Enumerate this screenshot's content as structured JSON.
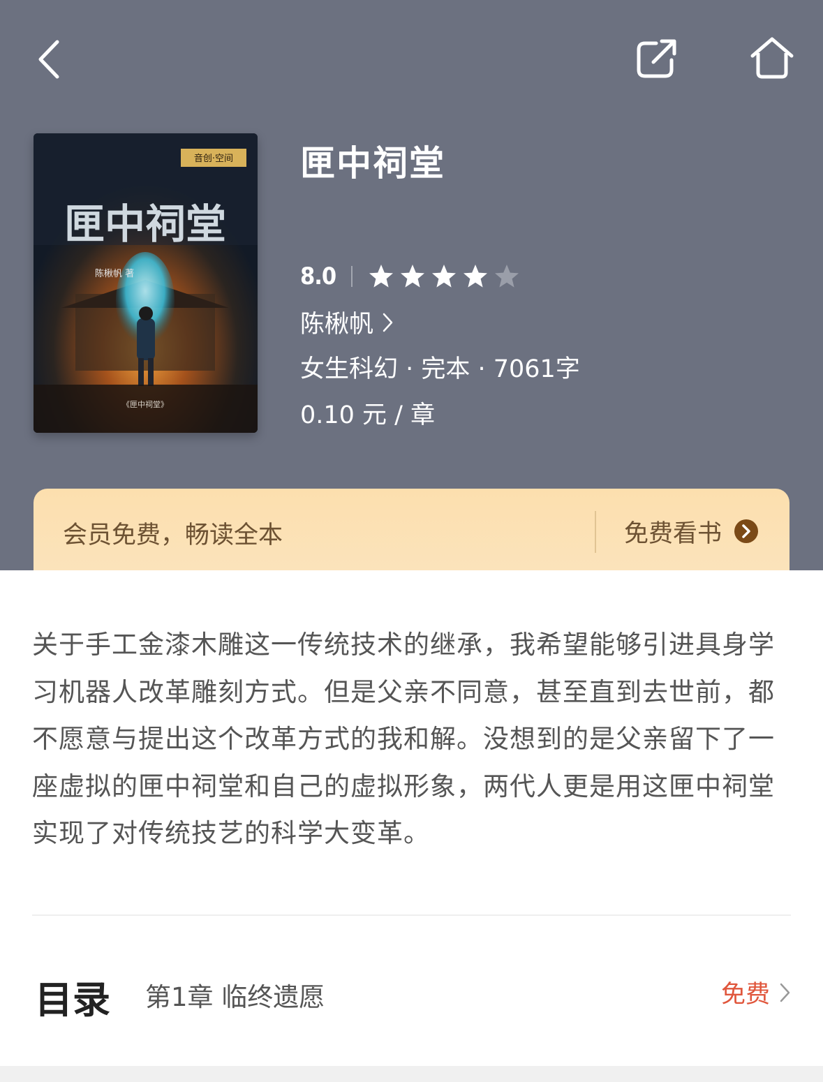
{
  "nav": {
    "back_icon": "chevron-left-icon",
    "share_icon": "share-icon",
    "home_icon": "home-icon"
  },
  "book": {
    "title": "匣中祠堂",
    "cover_title": "匣中祠堂",
    "cover_author": "陈楸帆 著",
    "cover_publisher": "音创·空间",
    "cover_caption": "《匣中祠堂》",
    "score": "8.0",
    "stars_filled": 4,
    "stars_total": 5,
    "author": "陈楸帆",
    "meta": "女生科幻 · 完本 · 7061字",
    "price": "0.10 元 / 章"
  },
  "vip": {
    "text": "会员免费，畅读全本",
    "button_label": "免费看书"
  },
  "synopsis": "关于手工金漆木雕这一传统技术的继承，我希望能够引进具身学习机器人改革雕刻方式。但是父亲不同意，甚至直到去世前，都不愿意与提出这个改革方式的我和解。没想到的是父亲留下了一座虚拟的匣中祠堂和自己的虚拟形象，两代人更是用这匣中祠堂实现了对传统技艺的科学大变革。",
  "toc": {
    "title": "目录",
    "chapter": "第1章 临终遗愿",
    "free_label": "免费"
  },
  "colors": {
    "header_bg": "#6c7180",
    "vip_bg": "#fcdfae",
    "vip_text": "#6d5233",
    "free_accent": "#e0563c",
    "star_filled": "#ffffff",
    "star_empty": "#9a9ea9"
  }
}
